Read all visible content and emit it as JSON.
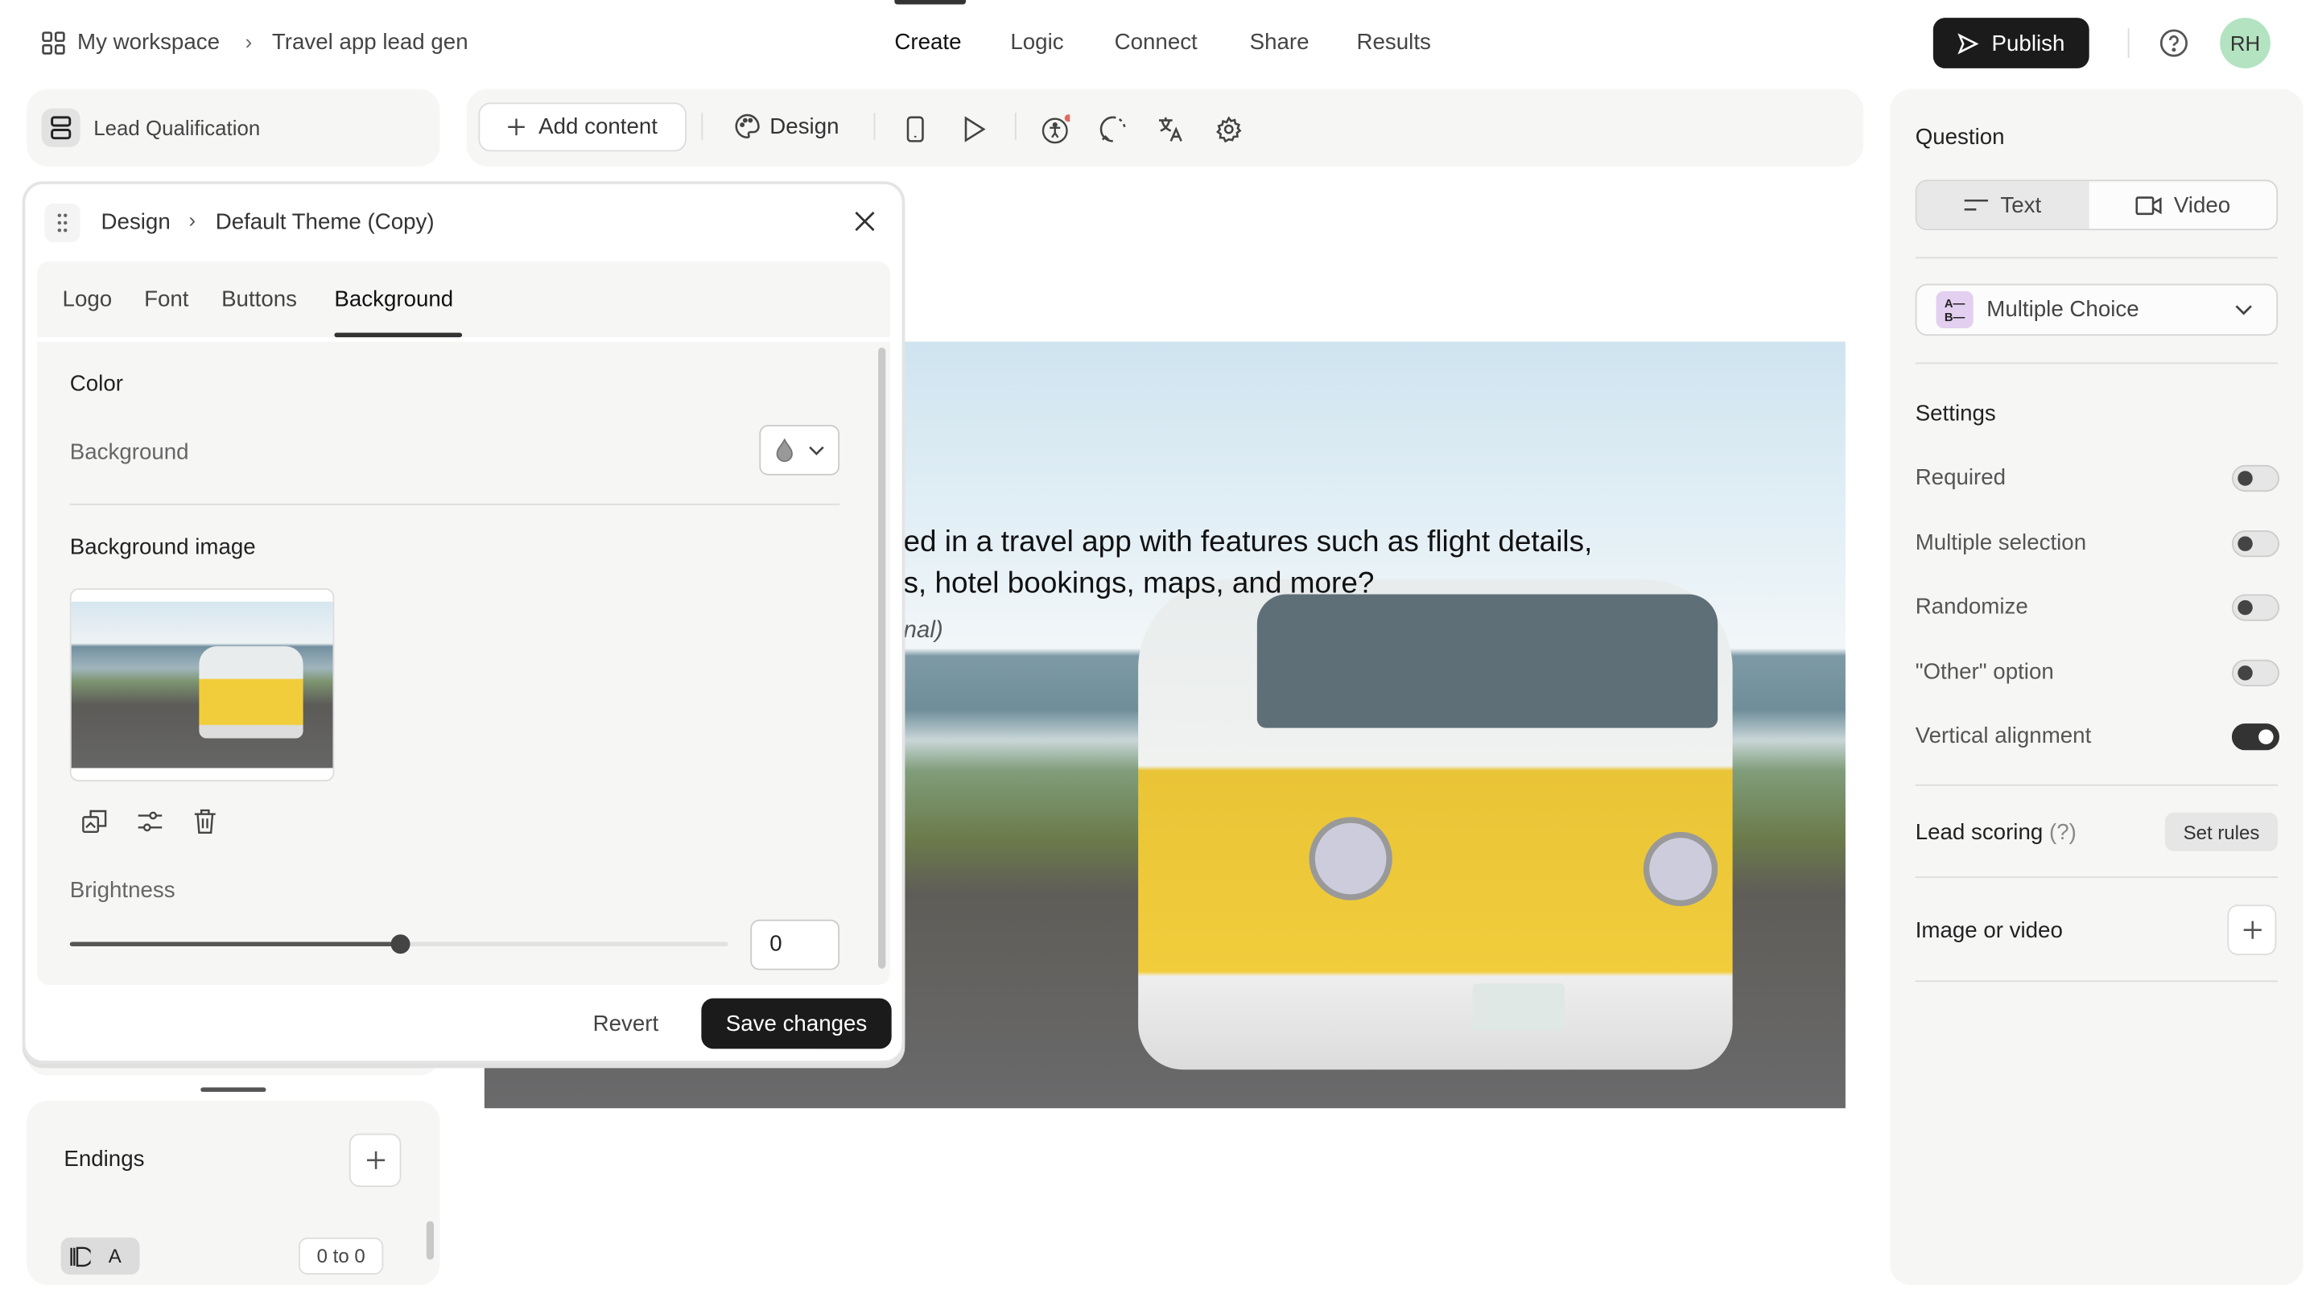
{
  "header": {
    "workspace": "My workspace",
    "project": "Travel app lead gen",
    "tabs": [
      "Create",
      "Logic",
      "Connect",
      "Share",
      "Results"
    ],
    "active_tab": "Create",
    "publish": "Publish",
    "avatar": "RH",
    "avatar_color": "#b3e3c0"
  },
  "left": {
    "form_name": "Lead Qualification",
    "endings": "Endings",
    "ending_letter": "A",
    "ending_range": "0 to 0"
  },
  "toolbar": {
    "add_content": "Add content",
    "design": "Design"
  },
  "design_panel": {
    "crumb_root": "Design",
    "crumb_theme": "Default Theme (Copy)",
    "tabs": [
      "Logo",
      "Font",
      "Buttons",
      "Background"
    ],
    "active_tab": "Background",
    "color_heading": "Color",
    "background_label": "Background",
    "bg_image_heading": "Background image",
    "brightness_label": "Brightness",
    "brightness_value": "0",
    "brightness_percent": 50,
    "revert": "Revert",
    "save": "Save changes"
  },
  "canvas": {
    "question_line1": "ed in a travel app with features such as flight details,",
    "question_line2": "s, hotel bookings, maps, and more?",
    "optional": "nal)"
  },
  "right": {
    "question_heading": "Question",
    "text_tab": "Text",
    "video_tab": "Video",
    "type": "Multiple Choice",
    "type_icon_color": "#e3cff0",
    "settings_heading": "Settings",
    "settings": [
      {
        "label": "Required",
        "on": false
      },
      {
        "label": "Multiple selection",
        "on": false
      },
      {
        "label": "Randomize",
        "on": false
      },
      {
        "label": "\"Other\" option",
        "on": false
      },
      {
        "label": "Vertical alignment",
        "on": true
      }
    ],
    "lead_scoring": "Lead scoring",
    "lead_scoring_hint": "(?)",
    "set_rules": "Set rules",
    "image_or_video": "Image or video"
  }
}
